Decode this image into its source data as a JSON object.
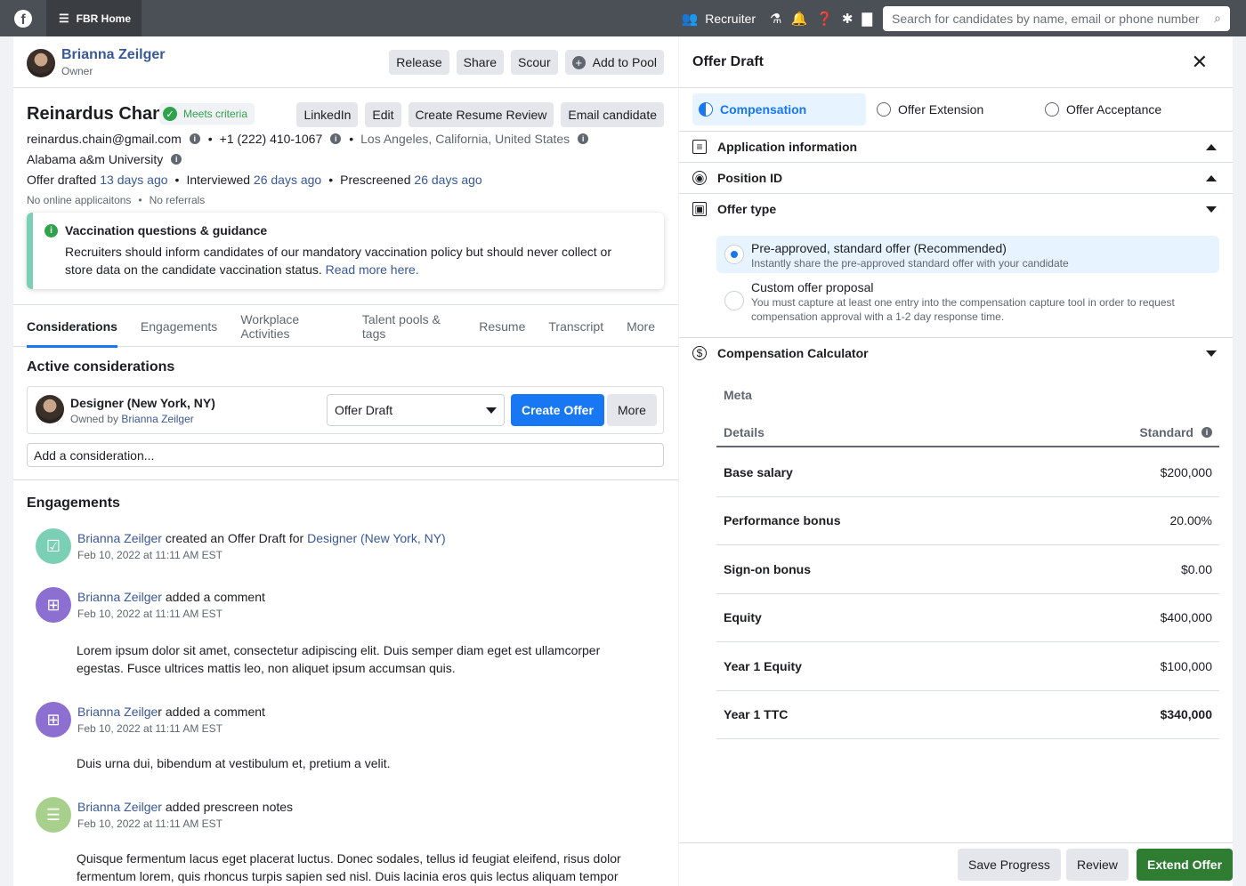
{
  "topbar": {
    "logo_letter": "f",
    "home_label": "FBR Home",
    "role_label": "Recruiter",
    "search_placeholder": "Search for candidates by name, email or phone number"
  },
  "owner": {
    "name": "Brianna Zeilger",
    "role": "Owner",
    "buttons": [
      "Release",
      "Share",
      "Scour",
      "Add to Pool"
    ]
  },
  "candidate": {
    "name": "Reinardus Chan",
    "criteria": "Meets criteria",
    "buttons": [
      "LinkedIn",
      "Edit",
      "Create Resume Review",
      "Email candidate"
    ],
    "email": "reinardus.chain@gmail.com",
    "phone": "+1 (222) 410-1067",
    "location": "Los Angeles, California, United States",
    "school": "Alabama a&m University",
    "offer_drafted_label": "Offer drafted",
    "offer_drafted_when": "13 days ago",
    "interviewed_label": "Interviewed",
    "interviewed_when": "26 days ago",
    "prescreened_label": "Prescreened",
    "prescreened_when": "26 days ago",
    "online_apps": "No online applicaitons",
    "referrals": "No referrals"
  },
  "vaccination": {
    "title": "Vaccination questions & guidance",
    "body": "Recruiters should inform candidates of our mandatory vaccination policy but should never collect or store data on the candidate vaccination status.",
    "link": "Read more here."
  },
  "tabs": [
    "Considerations",
    "Engagements",
    "Workplace Activities",
    "Talent pools & tags",
    "Resume",
    "Transcript",
    "More"
  ],
  "considerations": {
    "title": "Active considerations",
    "role": "Designer (New York, NY)",
    "owned_by_label": "Owned by",
    "owned_by": "Brianna Zeilger",
    "stage": "Offer Draft",
    "create_label": "Create Offer",
    "more_label": "More",
    "add_placeholder": "Add a consideration..."
  },
  "engagements": {
    "title": "Engagements",
    "items": [
      {
        "actor": "Brianna Zeilger",
        "action": "created an Offer Draft for",
        "target": "Designer (New York, NY)",
        "time": "Feb 10, 2022 at 11:11 AM EST",
        "body": ""
      },
      {
        "actor": "Brianna Zeilger",
        "action": "added a comment",
        "target": "",
        "time": "Feb 10, 2022 at 11:11 AM EST",
        "body": "Lorem ipsum dolor sit amet, consectetur adipiscing elit. Duis semper diam eget est ullamcorper egestas. Fusce ultrices mattis leo, non aliquet ipsum accumsan quis."
      },
      {
        "actor": "Brianna Zeilge",
        "actor_tail": "r",
        "action": "added a comment",
        "target": "",
        "time": "Feb 10, 2022 at 11:11 AM EST",
        "body": "Duis urna dui, bibendum at vestibulum et, pretium a velit."
      },
      {
        "actor": "Brianna Zeilger",
        "action": "added prescreen notes",
        "target": "",
        "time": "Feb 10, 2022 at 11:11 AM EST",
        "body": "Quisque fermentum lacus eget placerat luctus. Donec sodales, tellus id  feugiat eleifend, risus dolor fermentum lorem, quis rhoncus turpis  sapien sed nisl. Duis lacinia eros quis lectus aliquam tempor"
      }
    ]
  },
  "offer": {
    "title": "Offer Draft",
    "steps": [
      "Compensation",
      "Offer Extension",
      "Offer Acceptance"
    ],
    "sections": [
      "Application information",
      "Position ID",
      "Offer type",
      "Compensation Calculator"
    ],
    "offer_types": [
      {
        "title": "Pre-approved, standard offer (Recommended)",
        "desc": "Instantly share the pre-approved standard offer with your candidate",
        "selected": true
      },
      {
        "title": "Custom offer proposal",
        "desc": "You must capture at least one entry into the compensation capture tool in order to request compensation approval with a 1-2 day response time.",
        "selected": false
      }
    ],
    "calculator": {
      "meta_label": "Meta",
      "details_label": "Details",
      "standard_label": "Standard",
      "rows": [
        {
          "label": "Base salary",
          "value": "$200,000"
        },
        {
          "label": "Performance bonus",
          "value": "20.00%"
        },
        {
          "label": "Sign-on bonus",
          "value": "$0.00"
        },
        {
          "label": "Equity",
          "value": "$400,000"
        },
        {
          "label": "Year 1 Equity",
          "value": "$100,000"
        },
        {
          "label": "Year 1 TTC",
          "value": "$340,000"
        }
      ]
    },
    "footer": {
      "save": "Save Progress",
      "review": "Review",
      "extend": "Extend Offer"
    }
  },
  "colors": {
    "accent": "#1877f2",
    "link": "#385898",
    "success": "#31a24c",
    "extend": "#2e7d32",
    "topbar": "#4b4f56"
  }
}
